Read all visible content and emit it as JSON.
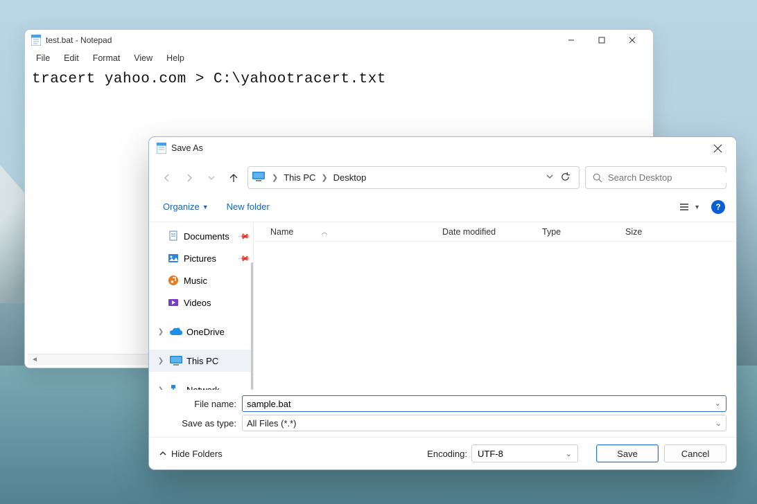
{
  "notepad": {
    "title": "test.bat - Notepad",
    "menu": {
      "file": "File",
      "edit": "Edit",
      "format": "Format",
      "view": "View",
      "help": "Help"
    },
    "content": "tracert yahoo.com > C:\\yahootracert.txt"
  },
  "dialog": {
    "title": "Save As",
    "breadcrumb": {
      "root": "This PC",
      "folder": "Desktop"
    },
    "search_placeholder": "Search Desktop",
    "toolbar": {
      "organize": "Organize",
      "new_folder": "New folder"
    },
    "columns": {
      "name": "Name",
      "date": "Date modified",
      "type": "Type",
      "size": "Size"
    },
    "sidebar": {
      "documents": "Documents",
      "pictures": "Pictures",
      "music": "Music",
      "videos": "Videos",
      "onedrive": "OneDrive",
      "thispc": "This PC",
      "network": "Network"
    },
    "fields": {
      "filename_label": "File name:",
      "filename_value": "sample.bat",
      "savetype_label": "Save as type:",
      "savetype_value": "All Files  (*.*)"
    },
    "footer": {
      "hide_folders": "Hide Folders",
      "encoding_label": "Encoding:",
      "encoding_value": "UTF-8",
      "save": "Save",
      "cancel": "Cancel"
    }
  }
}
